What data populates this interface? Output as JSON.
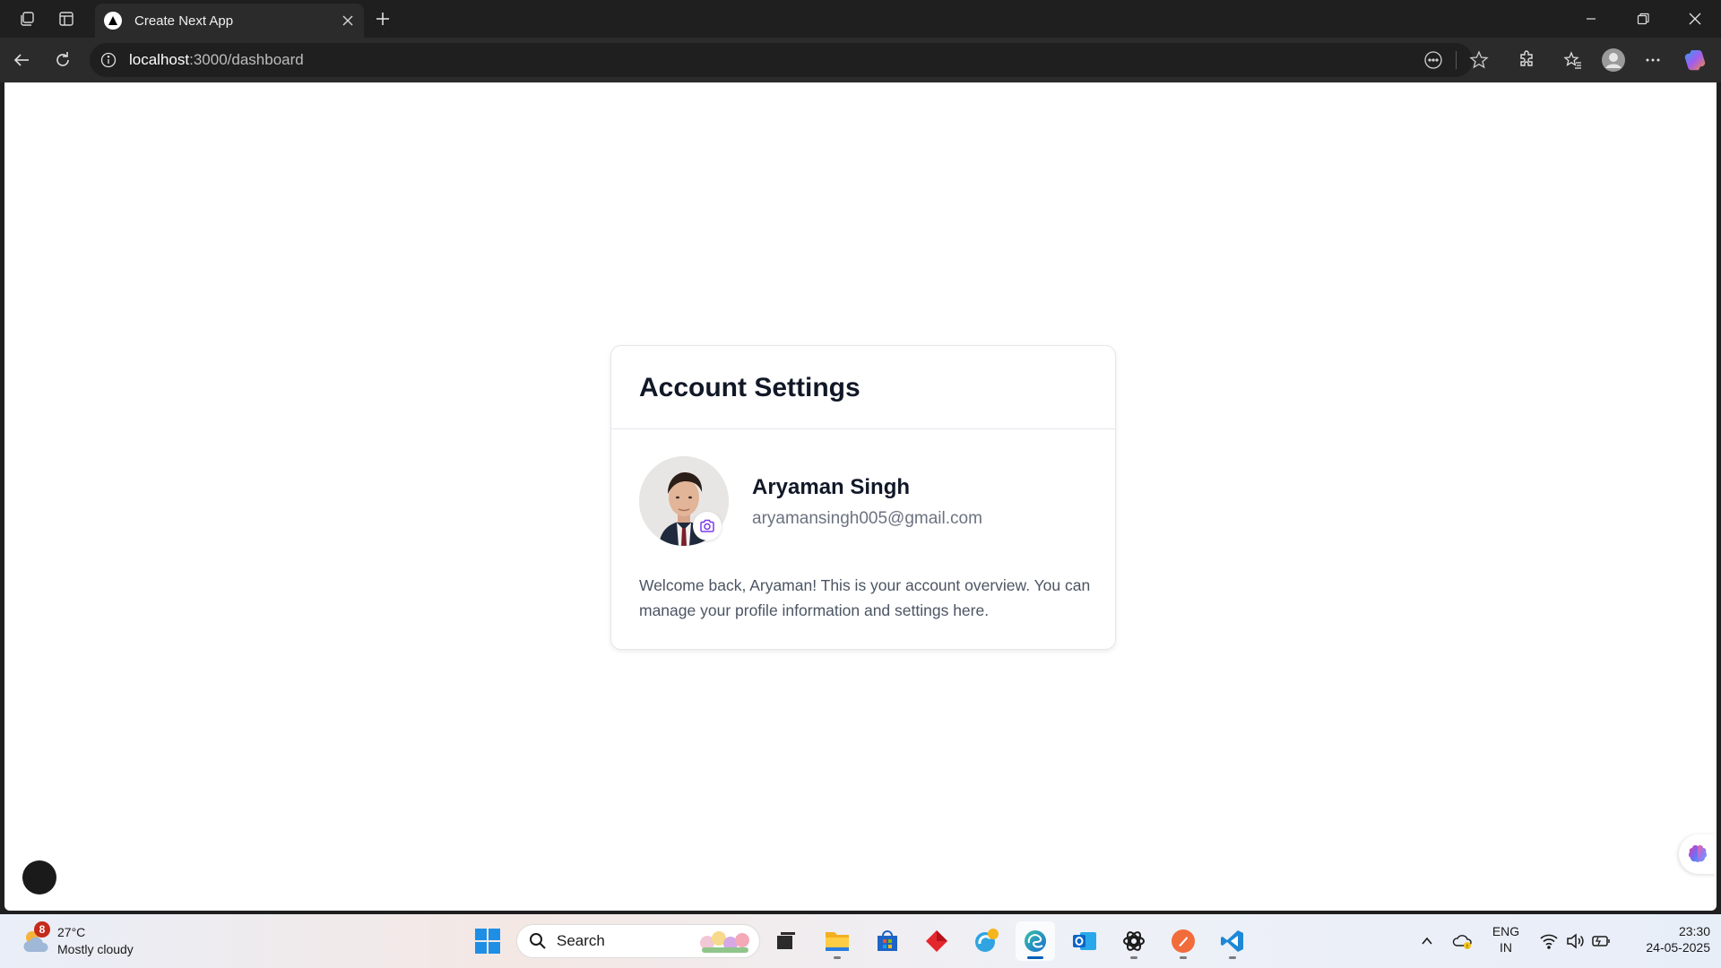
{
  "browser": {
    "tab_title": "Create Next App",
    "url_host": "localhost",
    "url_rest": ":3000/dashboard"
  },
  "page": {
    "card_title": "Account Settings",
    "user_name": "Aryaman Singh",
    "user_email": "aryamansingh005@gmail.com",
    "welcome_text": "Welcome back, Aryaman! This is your account overview. You can manage your profile information and settings here.",
    "accent_color": "#7c3aed"
  },
  "taskbar": {
    "weather_temp": "27°C",
    "weather_condition": "Mostly cloudy",
    "weather_badge": "8",
    "search_label": "Search",
    "lang_top": "ENG",
    "lang_bottom": "IN",
    "time": "23:30",
    "date": "24-05-2025",
    "apps": [
      "windows-start-icon",
      "task-view-icon",
      "file-explorer-icon",
      "microsoft-store-icon",
      "red-app-icon",
      "edge-beta-icon",
      "edge-icon",
      "outlook-icon",
      "chatgpt-icon",
      "postman-icon",
      "vscode-icon"
    ]
  }
}
